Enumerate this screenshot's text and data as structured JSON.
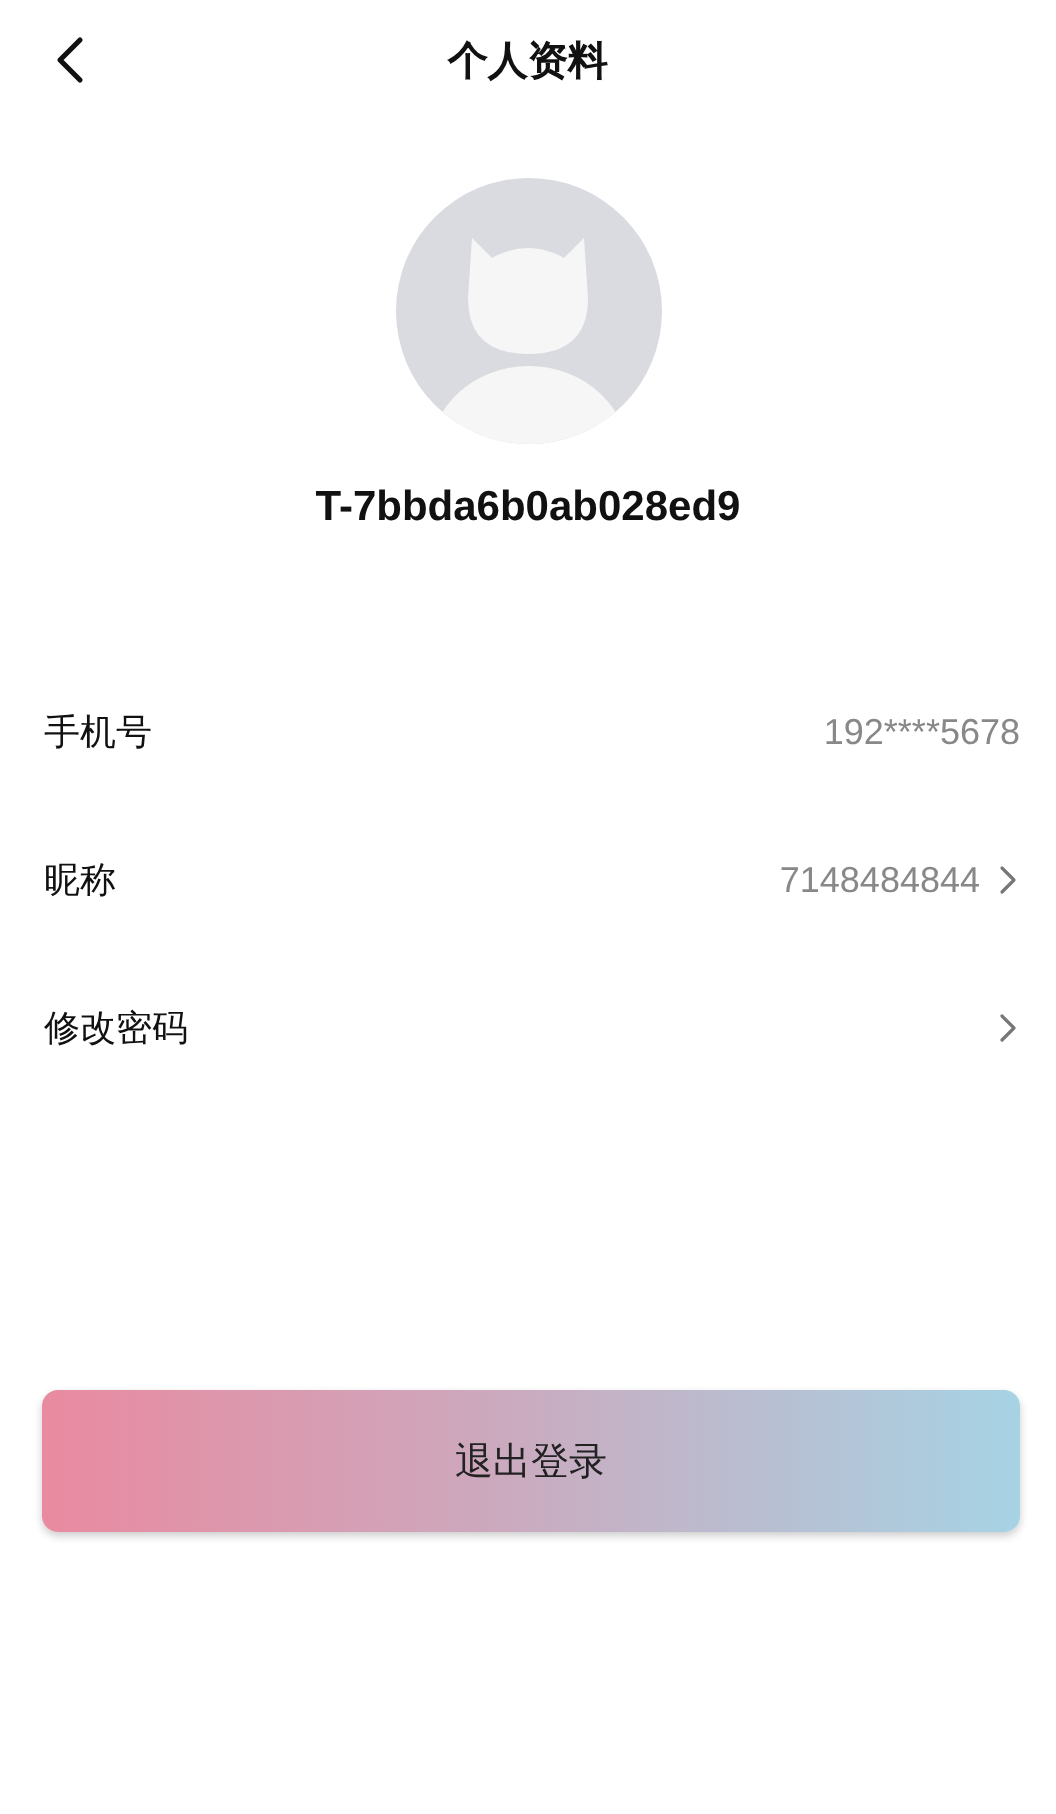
{
  "header": {
    "title": "个人资料"
  },
  "profile": {
    "username": "T-7bbda6b0ab028ed9"
  },
  "rows": [
    {
      "label": "手机号",
      "value": "192****5678",
      "chevron": false
    },
    {
      "label": "昵称",
      "value": "7148484844",
      "chevron": true
    },
    {
      "label": "修改密码",
      "chevron": true
    }
  ],
  "logout_button": {
    "label": "退出登录"
  }
}
